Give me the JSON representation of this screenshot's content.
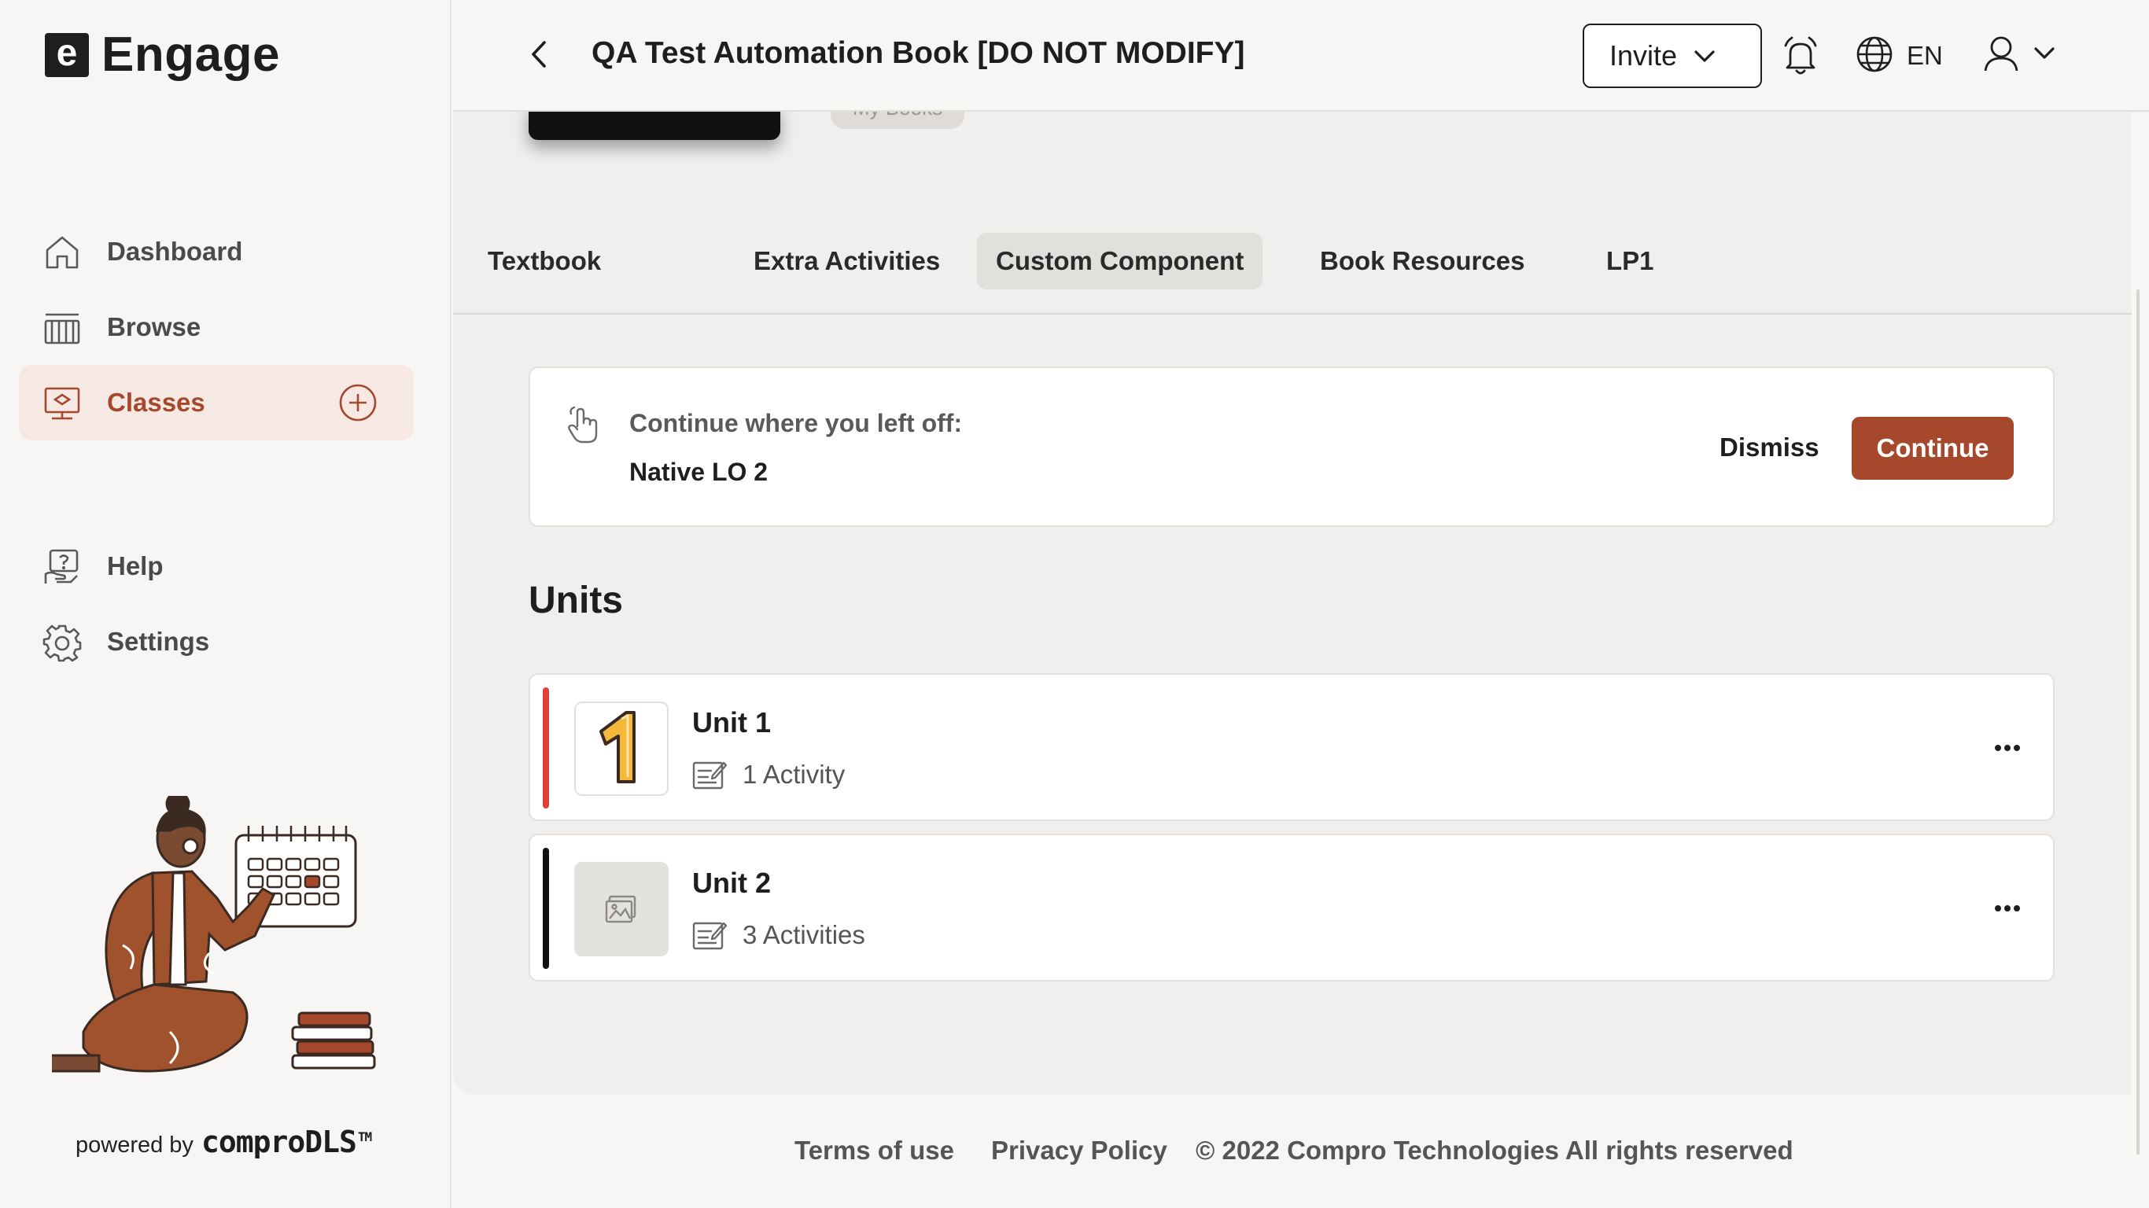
{
  "app": {
    "name": "Engage",
    "logo_letter": "e"
  },
  "sidebar": {
    "items": [
      {
        "label": "Dashboard",
        "icon": "home-icon"
      },
      {
        "label": "Browse",
        "icon": "library-icon"
      },
      {
        "label": "Classes",
        "icon": "classroom-icon",
        "active": true
      },
      {
        "label": "Help",
        "icon": "help-icon"
      },
      {
        "label": "Settings",
        "icon": "gear-icon"
      }
    ],
    "powered_by": "powered by",
    "brand": "comproDLS",
    "trademark": "TM"
  },
  "header": {
    "title": "QA Test Automation Book [DO NOT MODIFY]",
    "invite_label": "Invite",
    "language": "EN"
  },
  "book": {
    "chip_label": "My Books",
    "tabs": [
      {
        "label": "Textbook"
      },
      {
        "label": "Extra Activities"
      },
      {
        "label": "Custom Component",
        "active": true
      },
      {
        "label": "Book Resources"
      },
      {
        "label": "LP1"
      }
    ]
  },
  "resume": {
    "label": "Continue where you left off:",
    "item": "Native LO 2",
    "dismiss": "Dismiss",
    "continue": "Continue"
  },
  "units": {
    "heading": "Units",
    "items": [
      {
        "title": "Unit 1",
        "activities": "1 Activity",
        "thumb_text": "1",
        "bar_color": "#e0403a"
      },
      {
        "title": "Unit 2",
        "activities": "3 Activities",
        "thumb_text": "",
        "bar_color": "#111111"
      }
    ]
  },
  "footer": {
    "terms": "Terms of use",
    "privacy": "Privacy Policy",
    "copyright": "© 2022 Compro Technologies All rights reserved"
  },
  "colors": {
    "accent": "#a5482c",
    "active_bg": "#f6e9e4"
  }
}
